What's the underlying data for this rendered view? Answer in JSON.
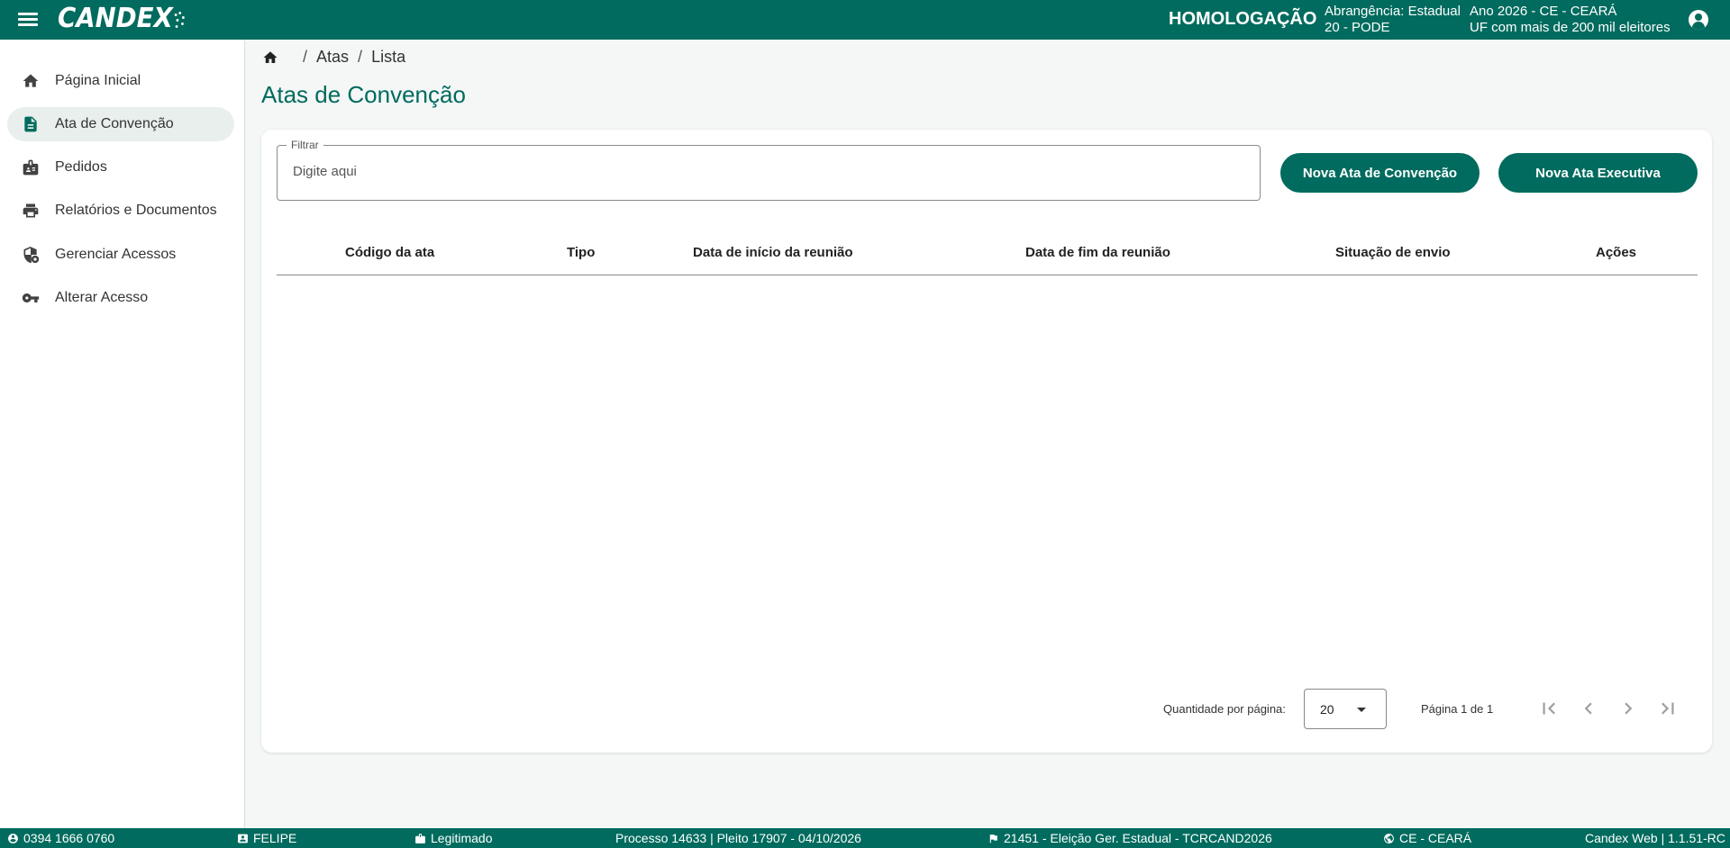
{
  "header": {
    "app_name": "CANDEX",
    "environment": "HOMOLOGAÇÃO",
    "scope_line1": "Abrangência: Estadual",
    "scope_line2": "20 - PODE",
    "year_line1": "Ano 2026 - CE - CEARÁ",
    "year_line2": "UF com mais de 200 mil eleitores"
  },
  "sidebar": {
    "items": [
      {
        "label": "Página Inicial",
        "icon": "home-icon"
      },
      {
        "label": "Ata de Convenção",
        "icon": "document-icon",
        "active": true
      },
      {
        "label": "Pedidos",
        "icon": "badge-icon"
      },
      {
        "label": "Relatórios e Documentos",
        "icon": "printer-icon"
      },
      {
        "label": "Gerenciar Acessos",
        "icon": "shield-lock-icon"
      },
      {
        "label": "Alterar Acesso",
        "icon": "key-icon"
      }
    ]
  },
  "breadcrumb": {
    "items": [
      "Atas",
      "Lista"
    ],
    "separator": "/"
  },
  "page": {
    "title": "Atas de Convenção"
  },
  "filter": {
    "label": "Filtrar",
    "placeholder": "Digite aqui",
    "value": ""
  },
  "actions": {
    "new_convention": "Nova Ata de Convenção",
    "new_executive": "Nova Ata Executiva"
  },
  "table": {
    "columns": [
      "Código da ata",
      "Tipo",
      "Data de início da reunião",
      "Data de fim da reunião",
      "Situação de envio",
      "Ações"
    ],
    "rows": []
  },
  "paginator": {
    "page_size_label": "Quantidade por página:",
    "page_size": "20",
    "range_label": "Página 1 de 1"
  },
  "footer": {
    "phone": "0394 1666 0760",
    "user": "FELIPE",
    "status": "Legitimado",
    "process": "Processo 14633 | Pleito 17907 - 04/10/2026",
    "election": "21451 - Eleição Ger. Estadual - TCRCAND2026",
    "state": "CE - CEARÁ",
    "version": "Candex Web | 1.1.51-RC"
  },
  "colors": {
    "primary": "#006b5e",
    "background": "#f4f7f6",
    "active_nav": "#e9efed"
  }
}
